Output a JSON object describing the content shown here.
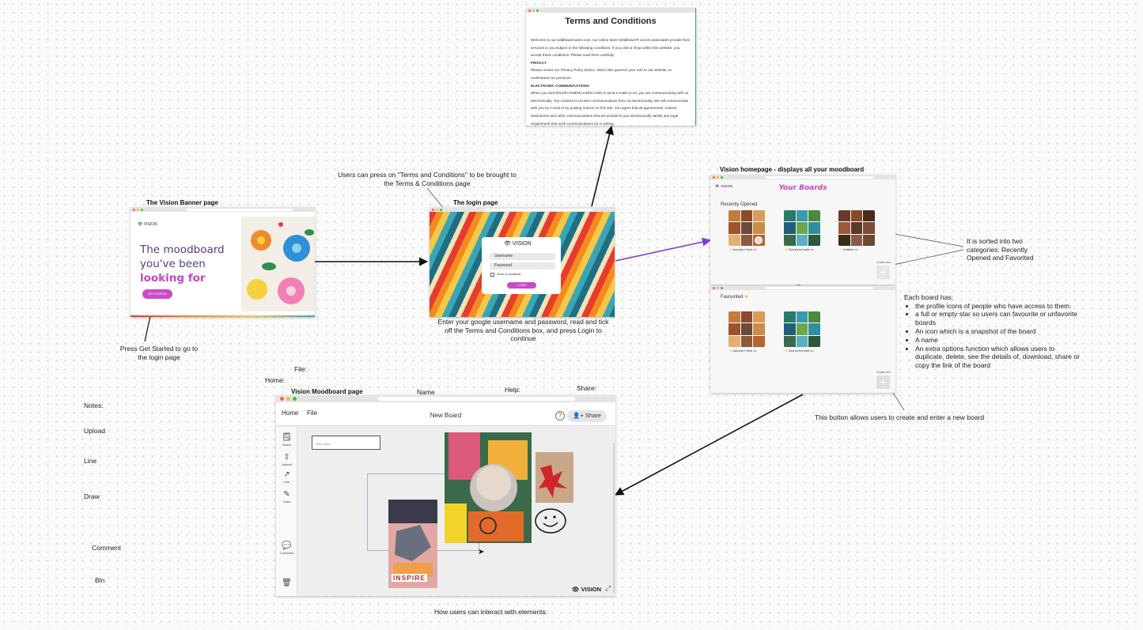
{
  "terms": {
    "title": "Terms and Conditions",
    "paragraphs": [
      {
        "text": "Welcome to our wildflowercases.com, our online store! Wildflower® and its associates provide their services to you subject to the following conditions. If you visit or shop within this website, you accept these conditions. Please read them carefully."
      },
      {
        "heading": "PRIVACY"
      },
      {
        "text": "Please review our Privacy Policy Notice, which also governs your visit to our website, to understand our practices."
      },
      {
        "heading": "ELECTRONIC COMMUNICATIONS"
      },
      {
        "text": "When you visit WILDFLOWERCASES.COM or send e-mails to us, you are communicating with us electronically. You consent to receive communications from us electronically. We will communicate with you by e-mail or by posting notices on this site. You agree that all agreements, notices, disclosures and other communications that we provide to you electronically satisfy any legal requirement that such communications be in writing."
      }
    ]
  },
  "annotations": {
    "terms_note": "Users can press on \"Terms and Conditions\"  to be brought to the Terms & Conditions page",
    "banner_title": "The Vision Banner page",
    "login_title": "The login page",
    "home_title": "Vision homepage - displays all your moodboard",
    "get_started_note": "Press Get Started to go to the login page",
    "login_note": "Enter your google username and password, read and tick off the Terms and Conditions box,  and press Login to continue",
    "sorted_note": "It is sorted into two categories: Recently Opened and Favorited",
    "each_board_title": "Each board has:",
    "each_board_items": [
      "the profile icons of people who have access to them.",
      "a full or empty star so users can favourite or unfavorite boards",
      "An icon which is a snapshot of the board",
      "A name",
      "An extra options function which allows users to duplicate, delete, see the details of, download, share or copy the link of the board"
    ],
    "new_board_note": "This button allows users to create and enter a new board",
    "file": "File:",
    "home": "Home:",
    "moodboard_title": "Vision Moodboard page",
    "name": "Name",
    "help": "Help:",
    "share": "Share:",
    "notes": "Notes:",
    "upload": "Upload",
    "line": "Line",
    "draw": "Draw",
    "comment": "Comment",
    "bin": "Bin",
    "interact_note": "How users can interact with elements:"
  },
  "banner": {
    "brand": "VISION",
    "headline_1": "The moodboard",
    "headline_2": "you've been",
    "headline_3": "looking for",
    "cta": "GET STARTED"
  },
  "login": {
    "brand": "VISION",
    "username_placeholder": "Username",
    "password_placeholder": "Password",
    "terms_label": "Terms & conditions",
    "button": "LOGIN"
  },
  "home": {
    "brand": "VISION",
    "heading": "Your Boards",
    "recently_opened": "Recently Opened",
    "favourited": "Favourited",
    "create_new": "Create new",
    "recent_boards": [
      {
        "name": "Autumn Finch",
        "starred": true
      },
      {
        "name": "Sea forest web",
        "starred": true
      },
      {
        "name": "Untitled",
        "starred": false
      }
    ],
    "favourite_boards": [
      {
        "name": "Autumn Finch",
        "starred": true
      },
      {
        "name": "Sea forest web",
        "starred": true
      }
    ],
    "more": "•••"
  },
  "moodboard": {
    "menu_home": "Home",
    "menu_file": "File",
    "board_name": "New Board",
    "help": "?",
    "share": "Share",
    "tools": {
      "notes": "Notes",
      "upload": "Upload",
      "line": "Line",
      "draw": "Draw",
      "comment": "Comment"
    },
    "note_placeholder": "Add notes...",
    "brand": "VISION",
    "inspire": "INSPIRE"
  },
  "colors": {
    "accent_pink": "#c445c4",
    "arrow_purple": "#7a3fd0",
    "brand_purple": "#5a3a78"
  }
}
